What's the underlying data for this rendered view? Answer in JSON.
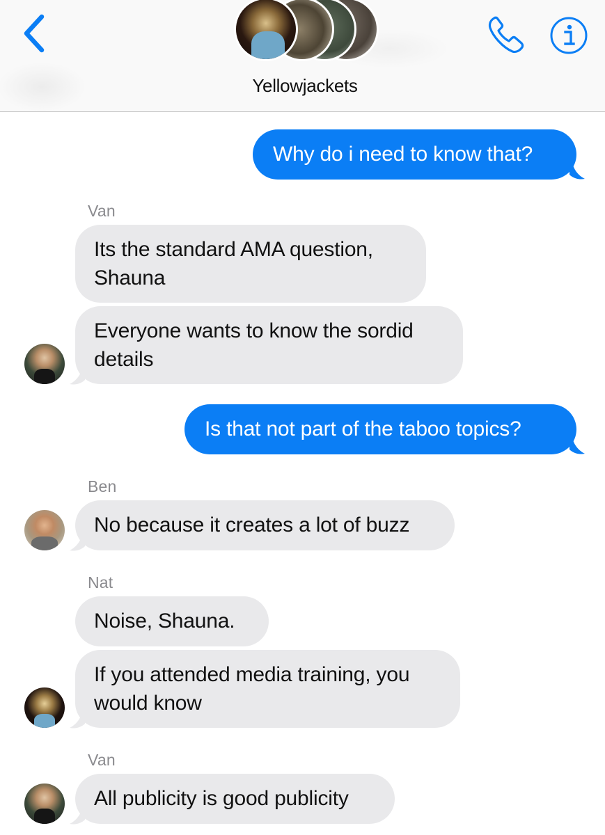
{
  "header": {
    "title": "Yellowjackets",
    "back_icon": "chevron-left-icon",
    "call_icon": "phone-icon",
    "info_icon": "info-icon",
    "accent_color": "#0b7ef5"
  },
  "messages": [
    {
      "direction": "outgoing",
      "text": "Why do i need to know that?"
    },
    {
      "direction": "incoming",
      "sender": "Van",
      "lines": [
        "Its the standard AMA question,",
        "Shauna"
      ]
    },
    {
      "direction": "incoming",
      "lines": [
        "Everyone wants to know the sordid",
        "details"
      ]
    },
    {
      "direction": "outgoing",
      "text": "Is that not part of the taboo topics?"
    },
    {
      "direction": "incoming",
      "sender": "Ben",
      "text": "No because it creates a lot of buzz"
    },
    {
      "direction": "incoming",
      "sender": "Nat",
      "text": "Noise, Shauna."
    },
    {
      "direction": "incoming",
      "lines": [
        "If you attended media training, you",
        "would know"
      ]
    },
    {
      "direction": "incoming",
      "sender": "Van",
      "text": "All publicity is good publicity"
    }
  ],
  "colors": {
    "outgoing_bubble": "#0b7ef5",
    "incoming_bubble": "#e9e9eb",
    "sender_label": "#8a8a8e"
  }
}
